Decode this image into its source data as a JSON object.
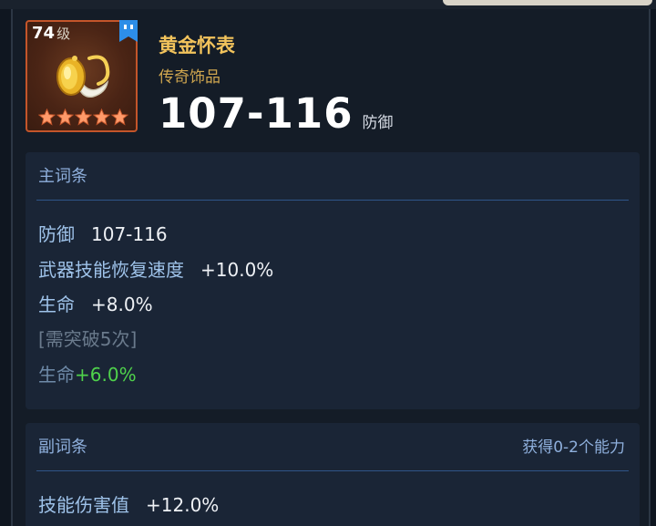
{
  "item": {
    "level": "74",
    "level_suffix": "级",
    "name": "黄金怀表",
    "rarity": "传奇饰品",
    "stat_value": "107-116",
    "stat_unit": "防御",
    "stars": 5
  },
  "main_stats": {
    "title": "主词条",
    "rows": [
      {
        "name": "防御",
        "value": "107-116"
      },
      {
        "name": "武器技能恢复速度",
        "value": "+10.0%"
      },
      {
        "name": "生命",
        "value": "+8.0%"
      }
    ],
    "locked_note": "[需突破5次]",
    "locked_row": {
      "name": "生命",
      "value": "+6.0%"
    }
  },
  "sub_stats": {
    "title": "副词条",
    "hint": "获得0-2个能力",
    "rows": [
      {
        "name": "技能伤害值",
        "value": "+12.0%"
      }
    ]
  },
  "colors": {
    "gold_name": "#f2c35c",
    "rarity": "#cfa64f",
    "attr_blue": "#9fc3ea",
    "green_bonus": "#4fd24b",
    "icon_border": "#c4552a"
  },
  "icons": [
    "bookmark-icon",
    "gold-pocket-watch-icon",
    "star-icon"
  ]
}
